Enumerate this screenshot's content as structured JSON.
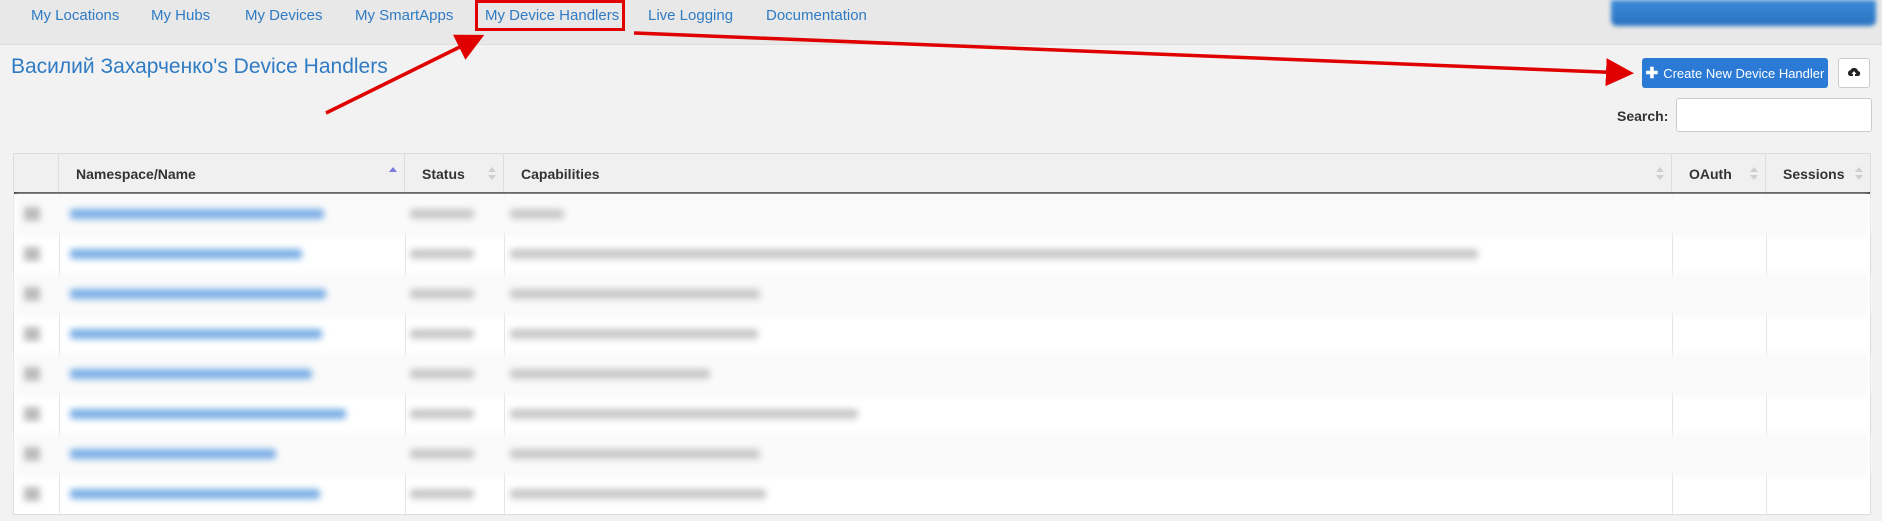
{
  "nav": {
    "items": [
      {
        "label": "My Locations"
      },
      {
        "label": "My Hubs"
      },
      {
        "label": "My Devices"
      },
      {
        "label": "My SmartApps"
      },
      {
        "label": "My Device Handlers"
      },
      {
        "label": "Live Logging"
      },
      {
        "label": "Documentation"
      }
    ],
    "active_index": 4
  },
  "page": {
    "title": "Василий Захарченко's Device Handlers"
  },
  "toolbar": {
    "create_label": "Create New Device Handler",
    "create_icon": "plus-icon",
    "upload_icon": "cloud-upload-icon"
  },
  "search": {
    "label": "Search:",
    "value": ""
  },
  "table": {
    "columns": [
      {
        "label": "",
        "key": "select"
      },
      {
        "label": "Namespace/Name",
        "sort": "asc"
      },
      {
        "label": "Status",
        "sort": "none"
      },
      {
        "label": "Capabilities",
        "sort": "none"
      },
      {
        "label": "OAuth",
        "sort": "none"
      },
      {
        "label": "Sessions",
        "sort": "none"
      }
    ],
    "row_count_visible": 8
  },
  "colors": {
    "accent": "#2a7ad6",
    "link": "#2f7bc4",
    "annotation": "#e00000"
  }
}
